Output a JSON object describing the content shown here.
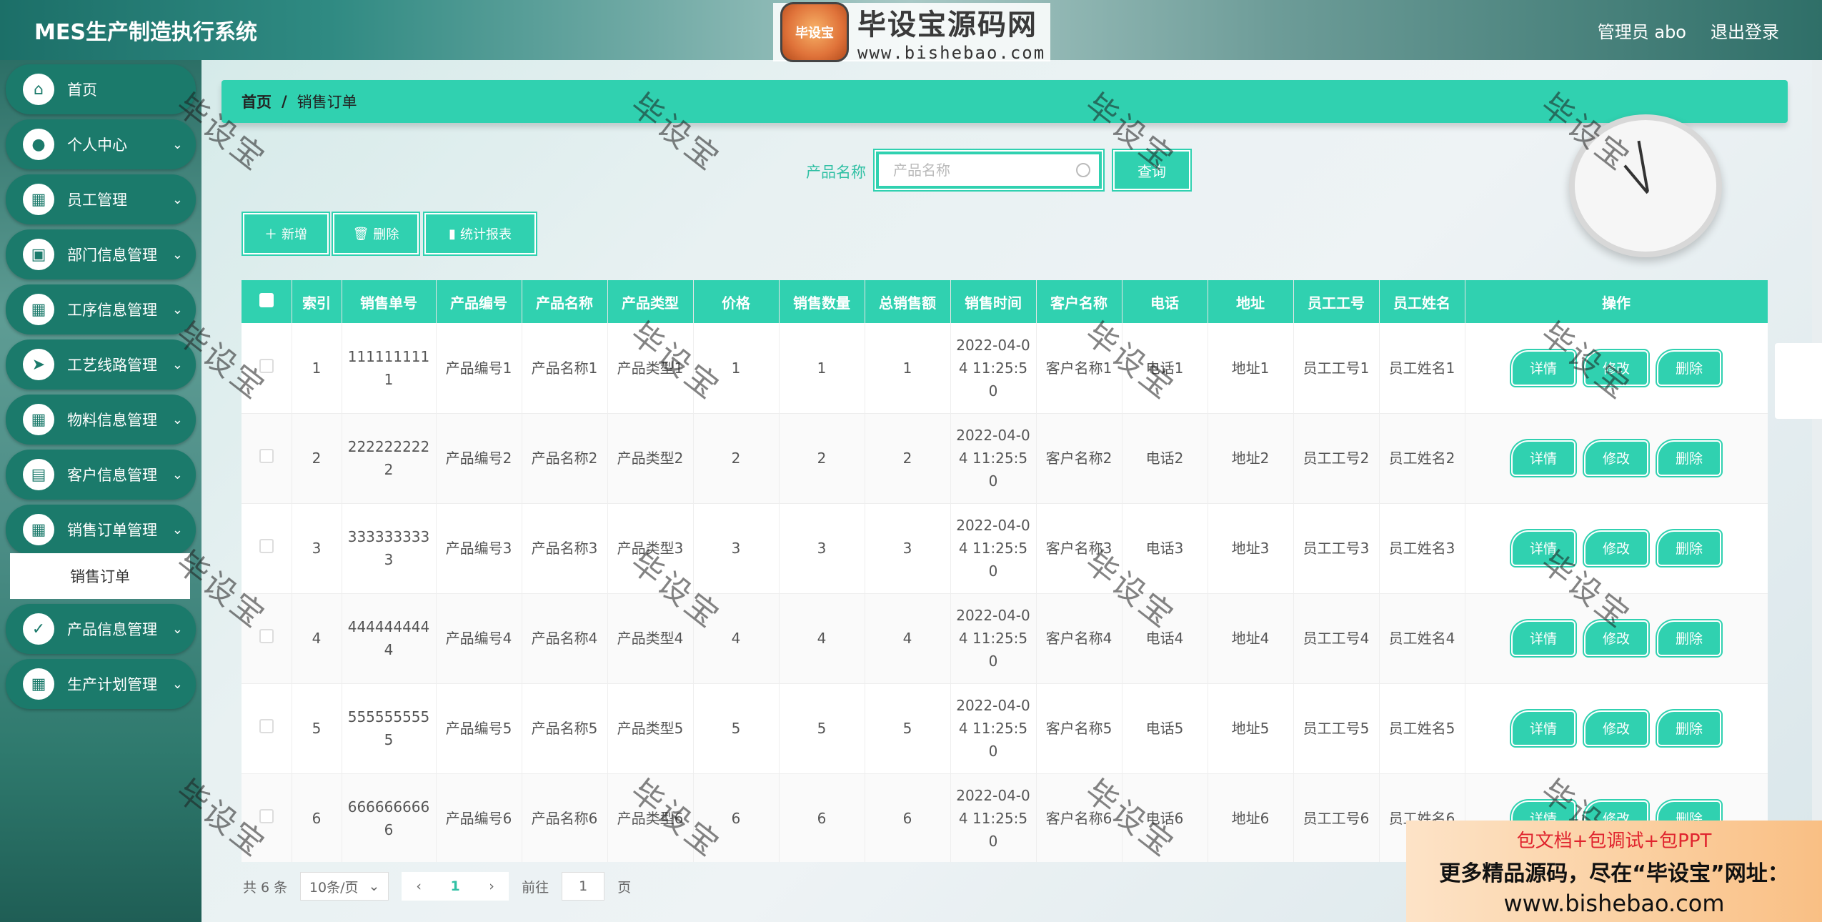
{
  "header": {
    "title": "MES生产制造执行系统",
    "logo_badge": "毕设宝",
    "logo_cn": "毕设宝源码网",
    "logo_url": "www.bishebao.com",
    "user_label": "管理员 abo",
    "logout_label": "退出登录"
  },
  "sidebar": {
    "items": [
      {
        "label": "首页",
        "icon": "home-icon"
      },
      {
        "label": "个人中心",
        "icon": "user-icon"
      },
      {
        "label": "员工管理",
        "icon": "grid-icon"
      },
      {
        "label": "部门信息管理",
        "icon": "wallet-icon"
      },
      {
        "label": "工序信息管理",
        "icon": "grid-icon"
      },
      {
        "label": "工艺线路管理",
        "icon": "send-icon"
      },
      {
        "label": "物料信息管理",
        "icon": "grid-icon"
      },
      {
        "label": "客户信息管理",
        "icon": "chart-icon"
      },
      {
        "label": "销售订单管理",
        "icon": "grid-icon"
      },
      {
        "label": "产品信息管理",
        "icon": "clipboard-icon"
      },
      {
        "label": "生产计划管理",
        "icon": "grid-icon"
      }
    ],
    "submenu_active": "销售订单"
  },
  "breadcrumb": {
    "home": "首页",
    "sep": "/",
    "current": "销售订单"
  },
  "search": {
    "label": "产品名称",
    "placeholder": "产品名称",
    "button": "查询"
  },
  "toolbar": {
    "add": "新增",
    "delete": "删除",
    "stats": "统计报表"
  },
  "table": {
    "headers": [
      "索引",
      "销售单号",
      "产品编号",
      "产品名称",
      "产品类型",
      "价格",
      "销售数量",
      "总销售额",
      "销售时间",
      "客户名称",
      "电话",
      "地址",
      "员工工号",
      "员工姓名",
      "操作"
    ],
    "rows": [
      [
        "1",
        "1111111111",
        "产品编号1",
        "产品名称1",
        "产品类型1",
        "1",
        "1",
        "1",
        "2022-04-04 11:25:50",
        "客户名称1",
        "电话1",
        "地址1",
        "员工工号1",
        "员工姓名1"
      ],
      [
        "2",
        "2222222222",
        "产品编号2",
        "产品名称2",
        "产品类型2",
        "2",
        "2",
        "2",
        "2022-04-04 11:25:50",
        "客户名称2",
        "电话2",
        "地址2",
        "员工工号2",
        "员工姓名2"
      ],
      [
        "3",
        "3333333333",
        "产品编号3",
        "产品名称3",
        "产品类型3",
        "3",
        "3",
        "3",
        "2022-04-04 11:25:50",
        "客户名称3",
        "电话3",
        "地址3",
        "员工工号3",
        "员工姓名3"
      ],
      [
        "4",
        "4444444444",
        "产品编号4",
        "产品名称4",
        "产品类型4",
        "4",
        "4",
        "4",
        "2022-04-04 11:25:50",
        "客户名称4",
        "电话4",
        "地址4",
        "员工工号4",
        "员工姓名4"
      ],
      [
        "5",
        "5555555555",
        "产品编号5",
        "产品名称5",
        "产品类型5",
        "5",
        "5",
        "5",
        "2022-04-04 11:25:50",
        "客户名称5",
        "电话5",
        "地址5",
        "员工工号5",
        "员工姓名5"
      ],
      [
        "6",
        "6666666666",
        "产品编号6",
        "产品名称6",
        "产品类型6",
        "6",
        "6",
        "6",
        "2022-04-04 11:25:50",
        "客户名称6",
        "电话6",
        "地址6",
        "员工工号6",
        "员工姓名6"
      ]
    ],
    "actions": [
      "详情",
      "修改",
      "删除"
    ]
  },
  "pagination": {
    "total": "共 6 条",
    "page_size": "10条/页",
    "current_page": "1",
    "goto_prefix": "前往",
    "goto_value": "1",
    "goto_suffix": "页"
  },
  "watermark": "毕设宝",
  "ad": {
    "line1": "包文档+包调试+包PPT",
    "line2": "更多精品源码，尽在“毕设宝”网址：",
    "line3": "www.bishebao.com"
  },
  "colors": {
    "accent": "#30d1b0",
    "sidebar_item": "#1b7a6b"
  }
}
